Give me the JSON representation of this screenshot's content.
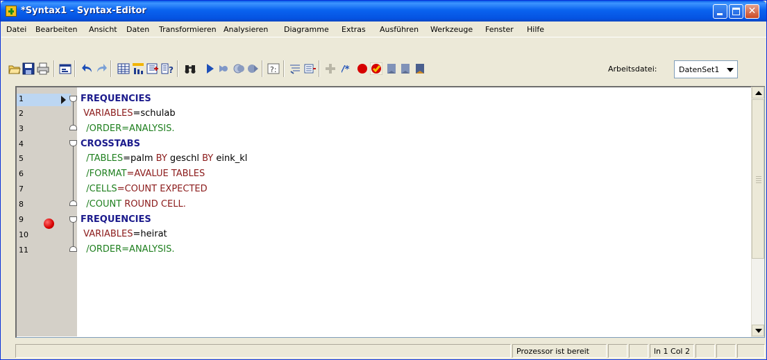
{
  "window": {
    "title": "*Syntax1 - Syntax-Editor"
  },
  "menu": [
    "Datei",
    "Bearbeiten",
    "Ansicht",
    "Daten",
    "Transformieren",
    "Analysieren",
    "Diagramme",
    "Extras",
    "Ausführen",
    "Werkzeuge",
    "Fenster",
    "Hilfe"
  ],
  "toolbar": {
    "icons": [
      "open-folder-icon",
      "save-icon",
      "print-icon",
      "recall-dialog-icon",
      "undo-icon",
      "redo-icon",
      "goto-case-icon",
      "variables-icon",
      "insert-cases-icon",
      "help-topics-icon",
      "find-icon",
      "run-selection-icon",
      "step-icon",
      "step-through-icon",
      "step-forward-icon",
      "syntax-help-icon",
      "comment-icon",
      "uncomment-icon",
      "add-icon",
      "comment-toggle-icon",
      "breakpoint-toggle-icon",
      "clear-breakpoints-icon",
      "bookmark-icon",
      "bookmark-next-icon",
      "bookmark-prev-icon"
    ],
    "dataset_label": "Arbeitsdatei:",
    "dataset_value": "DatenSet1"
  },
  "editor": {
    "lines": [
      {
        "num": "1"
      },
      {
        "num": "2"
      },
      {
        "num": "3"
      },
      {
        "num": "4"
      },
      {
        "num": "5"
      },
      {
        "num": "6"
      },
      {
        "num": "7"
      },
      {
        "num": "8"
      },
      {
        "num": "9"
      },
      {
        "num": "10"
      },
      {
        "num": "11"
      }
    ],
    "code": {
      "l1": "FREQUENCIES",
      "l2a": "VARIABLES",
      "l2b": "=schulab",
      "l3": "/ORDER=ANALYSIS.",
      "l4": "CROSSTABS",
      "l5a": "/TABLES",
      "l5b": "=palm ",
      "l5c": "BY",
      "l5d": " geschl ",
      "l5e": "BY",
      "l5f": " eink_kl",
      "l6a": "/FORMAT",
      "l6b": "=AVALUE TABLES",
      "l7a": "/CELLS",
      "l7b": "=COUNT EXPECTED",
      "l8a": "/COUNT",
      "l8b": " ROUND CELL.",
      "l9": "FREQUENCIES",
      "l10a": "VARIABLES",
      "l10b": "=heirat",
      "l11": "/ORDER=ANALYSIS."
    },
    "colors": {
      "keyword": "#1b1a8c",
      "subcommand": "#8b1a1a",
      "subcommand_green": "#1e7f1e",
      "breakpoint": "#d60000"
    }
  },
  "status": {
    "processor": "Prozessor ist bereit",
    "position": "ln 1 Col 2"
  }
}
